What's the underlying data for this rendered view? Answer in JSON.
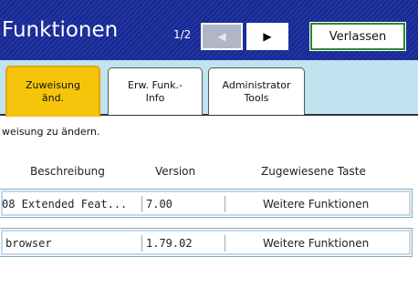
{
  "header": {
    "title": "Funktionen",
    "page_indicator": "1/2",
    "prev_icon": "◀",
    "next_icon": "▶",
    "exit_label": "Verlassen"
  },
  "tabs": [
    {
      "line1": "Zuweisung",
      "line2": "änd."
    },
    {
      "line1": "Erw. Funk.-",
      "line2": "Info"
    },
    {
      "line1": "Administrator",
      "line2": "Tools"
    }
  ],
  "notice": "weisung zu ändern.",
  "table": {
    "headers": [
      "Beschreibung",
      "Version",
      "Zugewiesene Taste"
    ],
    "rows": [
      {
        "description": "08 Extended Feat...",
        "version": "7.00",
        "key": "Weitere Funktionen"
      },
      {
        "description": "browser",
        "version": "1.79.02",
        "key": "Weitere Funktionen"
      }
    ]
  },
  "colors": {
    "header_bg": "#17288f",
    "tab_bar_bg": "#bfe3ef",
    "active_tab": "#f6c40a",
    "exit_border": "#2a8a2a"
  }
}
